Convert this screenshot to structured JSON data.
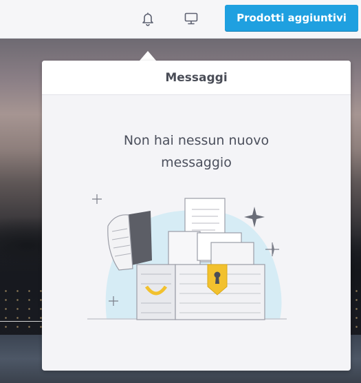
{
  "header": {
    "notifications_icon": "bell-icon",
    "display_icon": "desktop-icon",
    "primary_button_label": "Prodotti aggiuntivi",
    "primary_button_color": "#1fa0e0"
  },
  "messages_panel": {
    "title": "Messaggi",
    "empty_line1": "Non hai nessun nuovo",
    "empty_line2": "messaggio",
    "illustration": "treasure-chest-illustration"
  }
}
